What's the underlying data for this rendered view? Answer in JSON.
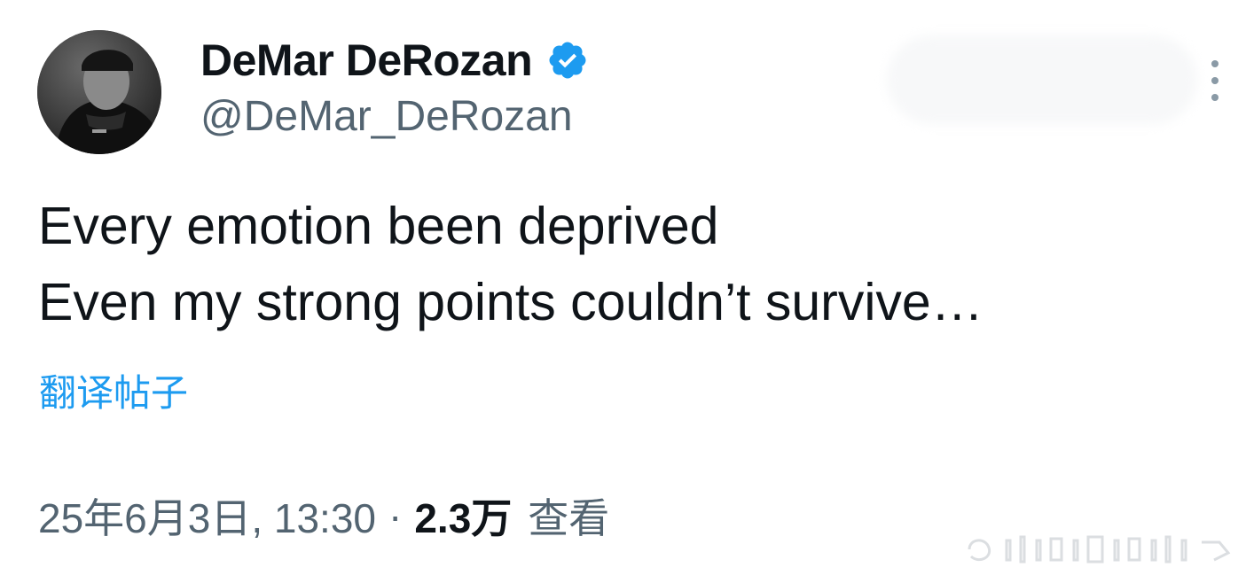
{
  "author": {
    "display_name": "DeMar DeRozan",
    "handle": "@DeMar_DeRozan",
    "verified": true,
    "verified_color": "#1d9bf0"
  },
  "tweet": {
    "lines": [
      "Every emotion been deprived",
      "Even my strong points couldn’t survive…"
    ],
    "translate_label": "翻译帖子"
  },
  "meta": {
    "timestamp": "25年6月3日, 13:30",
    "separator": "·",
    "views_count": "2.3万",
    "views_label": "查看"
  },
  "icons": {
    "avatar": "profile-photo",
    "verified": "verified-badge-icon",
    "more": "more-options-icon"
  },
  "colors": {
    "text": "#0f1419",
    "secondary": "#536471",
    "link": "#1d9bf0"
  }
}
